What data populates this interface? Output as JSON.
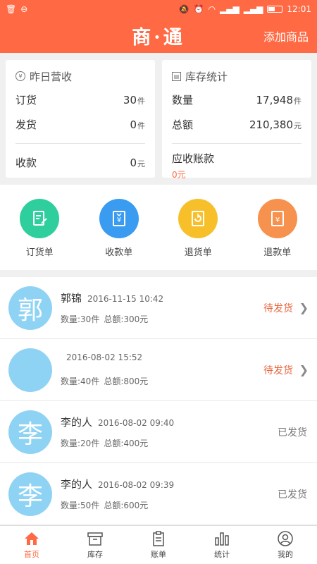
{
  "statusbar": {
    "time": "12:01"
  },
  "header": {
    "logo": "商·通",
    "add_label": "添加商品",
    "accent": "#ff6a44"
  },
  "yesterday": {
    "title": "昨日营收",
    "order_label": "订货",
    "order_value": "30",
    "order_unit": "件",
    "ship_label": "发货",
    "ship_value": "0",
    "ship_unit": "件",
    "collect_label": "收款",
    "collect_value": "0",
    "collect_unit": "元"
  },
  "inventory": {
    "title": "库存统计",
    "qty_label": "数量",
    "qty_value": "17,948",
    "qty_unit": "件",
    "total_label": "总额",
    "total_value": "210,380",
    "total_unit": "元",
    "receivable_label": "应收账款",
    "receivable_value": "0元"
  },
  "actions": [
    {
      "label": "订货单",
      "icon": "order-form-icon",
      "color": "#2ecf9c"
    },
    {
      "label": "收款单",
      "icon": "receipt-form-icon",
      "color": "#3a9cf0"
    },
    {
      "label": "退货单",
      "icon": "return-form-icon",
      "color": "#f7c02b"
    },
    {
      "label": "退款单",
      "icon": "refund-form-icon",
      "color": "#f7914e"
    }
  ],
  "orders": [
    {
      "avatar": "郭",
      "name": "郭锦",
      "time": "2016-11-15 10:42",
      "qty": "数量:30件",
      "amount": "总额:300元",
      "status": "待发货"
    },
    {
      "avatar": "",
      "name": "",
      "time": "2016-08-02 15:52",
      "qty": "数量:40件",
      "amount": "总额:800元",
      "status": "待发货"
    },
    {
      "avatar": "李",
      "name": "李的人",
      "time": "2016-08-02 09:40",
      "qty": "数量:20件",
      "amount": "总额:400元",
      "status": "已发货"
    },
    {
      "avatar": "李",
      "name": "李的人",
      "time": "2016-08-02 09:39",
      "qty": "数量:50件",
      "amount": "总额:600元",
      "status": "已发货"
    }
  ],
  "nav": [
    {
      "label": "首页",
      "icon": "home-icon"
    },
    {
      "label": "库存",
      "icon": "inventory-box-icon"
    },
    {
      "label": "账单",
      "icon": "bill-icon"
    },
    {
      "label": "统计",
      "icon": "stats-bar-icon"
    },
    {
      "label": "我的",
      "icon": "profile-icon"
    }
  ]
}
